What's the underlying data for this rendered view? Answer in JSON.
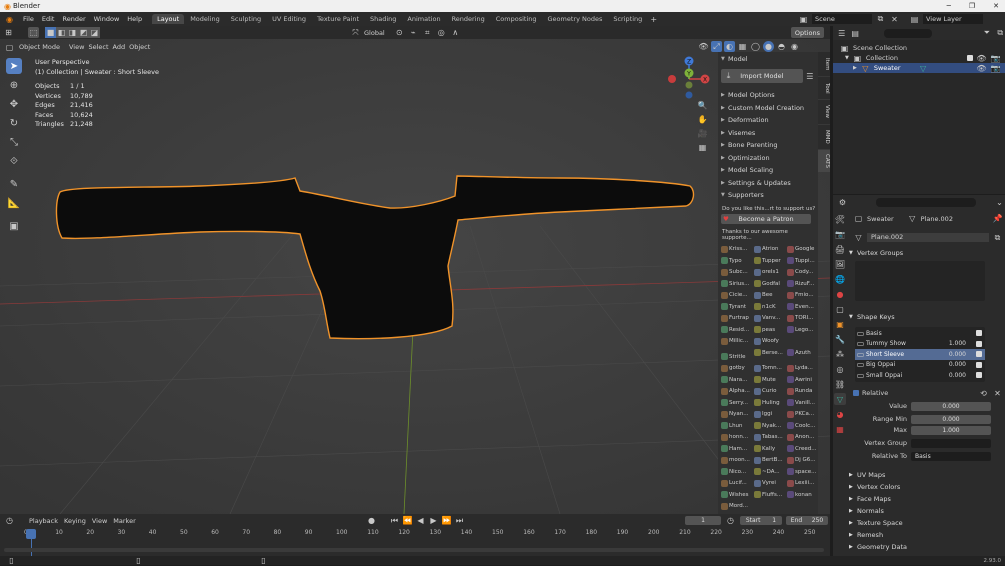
{
  "window": {
    "title": "Blender",
    "controls": [
      "─",
      "❐",
      "✕"
    ]
  },
  "menu": [
    "File",
    "Edit",
    "Render",
    "Window",
    "Help"
  ],
  "workspaces": [
    "Layout",
    "Modeling",
    "Sculpting",
    "UV Editing",
    "Texture Paint",
    "Shading",
    "Animation",
    "Rendering",
    "Compositing",
    "Geometry Nodes",
    "Scripting"
  ],
  "active_workspace": "Layout",
  "scene": "Scene",
  "view_layer": "View Layer",
  "viewport": {
    "mode": "Object Mode",
    "menus": [
      "View",
      "Select",
      "Add",
      "Object"
    ],
    "orientation": "Global",
    "options": "Options",
    "info_title": "User Perspective",
    "info_sub": "(1) Collection | Sweater : Short Sleeve",
    "stats": [
      {
        "k": "Objects",
        "v": "1 / 1"
      },
      {
        "k": "Vertices",
        "v": "10,789"
      },
      {
        "k": "Edges",
        "v": "21,416"
      },
      {
        "k": "Faces",
        "v": "10,624"
      },
      {
        "k": "Triangles",
        "v": "21,248"
      }
    ],
    "gizmo": {
      "z": "Z",
      "y": "Y",
      "x": "X"
    }
  },
  "npanel": {
    "header": "Model",
    "import_button": "Import Model",
    "sections": [
      "Model Options",
      "Custom Model Creation",
      "Deformation",
      "Visemes",
      "Bone Parenting",
      "Optimization",
      "Model Scaling",
      "Settings & Updates"
    ],
    "supporters_header": "Supporters",
    "like_text": "Do you like this...rt to support us?",
    "patron_button": "Become a Patron",
    "thanks_text": "Thanks to our awesome supporte...",
    "supporters": [
      "Kriss...",
      "Atrion",
      "Google",
      "Typo",
      "Tupper",
      "Tuppi...",
      "Subc...",
      "oreIs1",
      "Cody...",
      "Sirius...",
      "Godfal",
      "RizuF...",
      "Cicie...",
      "Bee",
      "Fmio...",
      "Tyrant",
      "n1cK",
      "Even...",
      "Furtrap",
      "Vanv...",
      "TORI...",
      "Resid...",
      "peas",
      "Lego...",
      "Millic...",
      "Woofy",
      "",
      "Stritle",
      "Berse...",
      "Azuth",
      "gotby",
      "Tomn...",
      "Lyda...",
      "Nara...",
      "Mute",
      "Awrini",
      "Alpha...",
      "Curio",
      "Runda",
      "Serry...",
      "Huling",
      "Vanill...",
      "Nyan...",
      "Iggi",
      "PKCa...",
      "Lhun",
      "Nyak...",
      "Coolc...",
      "honn...",
      "Tabas...",
      "Anon...",
      "Ham...",
      "Kally",
      "Creed...",
      "moon...",
      "BertB...",
      "Dj G6...",
      "Nico...",
      "~DA...",
      "space...",
      "Lucif...",
      "Vyrei",
      "Lexiii...",
      "Wishes",
      "Fluffs...",
      "konan",
      "Mord..."
    ],
    "side_tabs": [
      "Item",
      "Tool",
      "View",
      "MMD",
      "CATS"
    ]
  },
  "outliner": {
    "items": [
      {
        "label": "Scene Collection"
      },
      {
        "label": "Collection"
      },
      {
        "label": "Sweater"
      }
    ]
  },
  "properties": {
    "object": "Sweater",
    "mesh": "Plane.002",
    "mesh_field": "Plane.002",
    "vertex_groups": "Vertex Groups",
    "shape_keys_header": "Shape Keys",
    "shape_keys": [
      {
        "name": "Basis",
        "value": ""
      },
      {
        "name": "Tummy Show",
        "value": "1.000"
      },
      {
        "name": "Short Sleeve",
        "value": "0.000"
      },
      {
        "name": "Big Oppai",
        "value": "0.000"
      },
      {
        "name": "Small Oppai",
        "value": "0.000"
      }
    ],
    "relative_label": "Relative",
    "value_label": "Value",
    "value": "0.000",
    "range_min_label": "Range Min",
    "range_min": "0.000",
    "max_label": "Max",
    "max": "1.000",
    "vertex_group_label": "Vertex Group",
    "relative_to_label": "Relative To",
    "relative_to": "Basis",
    "collapsed": [
      "UV Maps",
      "Vertex Colors",
      "Face Maps",
      "Normals",
      "Texture Space",
      "Remesh",
      "Geometry Data"
    ]
  },
  "timeline": {
    "menus": [
      "Playback",
      "Keying",
      "View",
      "Marker"
    ],
    "current_frame": "1",
    "start_label": "Start",
    "start": "1",
    "end_label": "End",
    "end": "250",
    "ticks": [
      "0",
      "10",
      "20",
      "30",
      "40",
      "50",
      "60",
      "70",
      "80",
      "90",
      "100",
      "110",
      "120",
      "130",
      "140",
      "150",
      "160",
      "170",
      "180",
      "190",
      "200",
      "210",
      "220",
      "230",
      "240",
      "250"
    ]
  },
  "version": "2.93.0",
  "colors": {
    "accent": "#4772b3",
    "outline": "#f0932a",
    "selected_row": "#334d80",
    "bg": "#3d3d3d"
  }
}
